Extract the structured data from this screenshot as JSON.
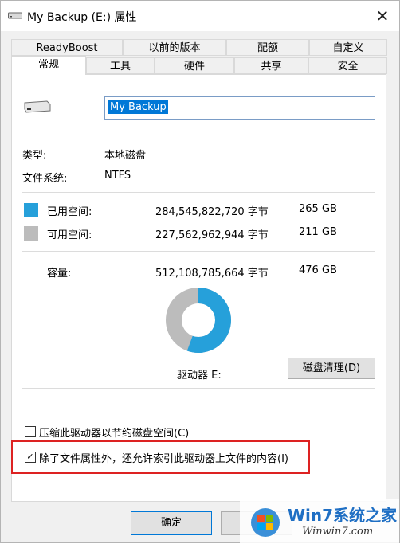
{
  "window": {
    "title": "My Backup (E:) 属性",
    "close_label": "✕"
  },
  "tabs_row1": [
    "ReadyBoost",
    "以前的版本",
    "配额",
    "自定义"
  ],
  "tabs_row2": [
    "常规",
    "工具",
    "硬件",
    "共享",
    "安全"
  ],
  "general": {
    "name_value": "My Backup",
    "type_label": "类型:",
    "type_value": "本地磁盘",
    "fs_label": "文件系统:",
    "fs_value": "NTFS",
    "used_label": "已用空间:",
    "used_bytes": "284,545,822,720 字节",
    "used_gb": "265 GB",
    "free_label": "可用空间:",
    "free_bytes": "227,562,962,944 字节",
    "free_gb": "211 GB",
    "capacity_label": "容量:",
    "capacity_bytes": "512,108,785,664 字节",
    "capacity_gb": "476 GB",
    "drive_label": "驱动器 E:",
    "cleanup_button": "磁盘清理(D)",
    "compress_label": "压缩此驱动器以节约磁盘空间(C)",
    "index_label": "除了文件属性外，还允许索引此驱动器上文件的内容(I)",
    "compress_checked": false,
    "index_checked": true,
    "used_fraction": 0.5556
  },
  "footer": {
    "ok_button": "确定"
  },
  "colors": {
    "used": "#26a0da",
    "free": "#bcbcbc",
    "highlight": "#d22222"
  },
  "watermark": {
    "brand": "Win7系统之家",
    "url": "Winwin7.com"
  }
}
